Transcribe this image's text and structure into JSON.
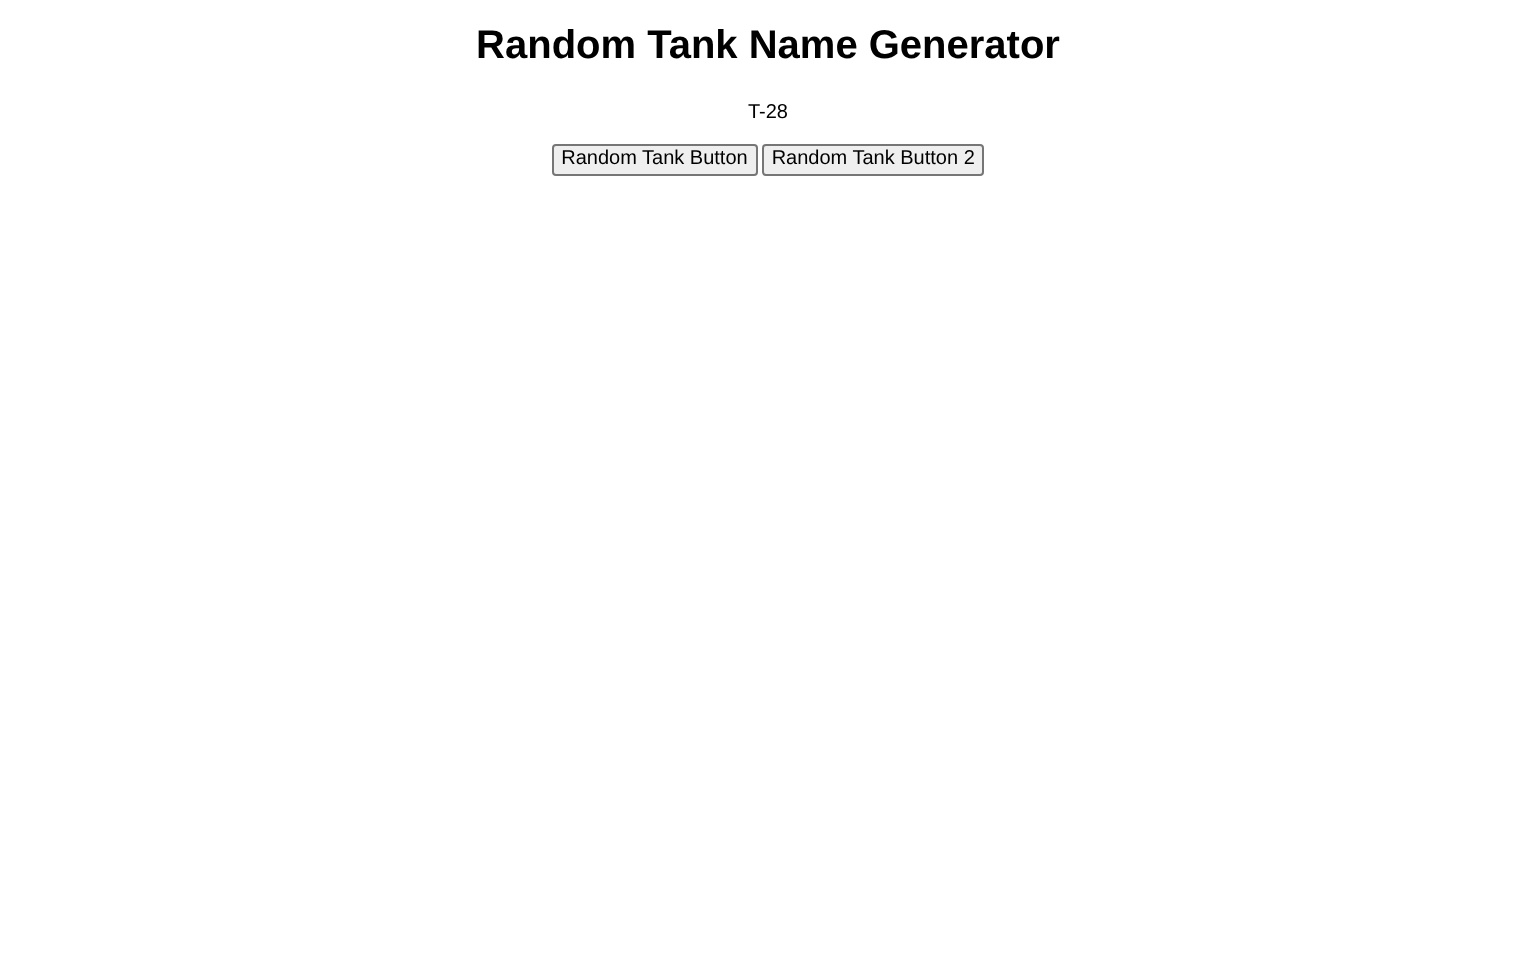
{
  "title": "Random Tank Name Generator",
  "result": "T-28",
  "buttons": [
    "Random Tank Button",
    "Random Tank Button 2"
  ]
}
